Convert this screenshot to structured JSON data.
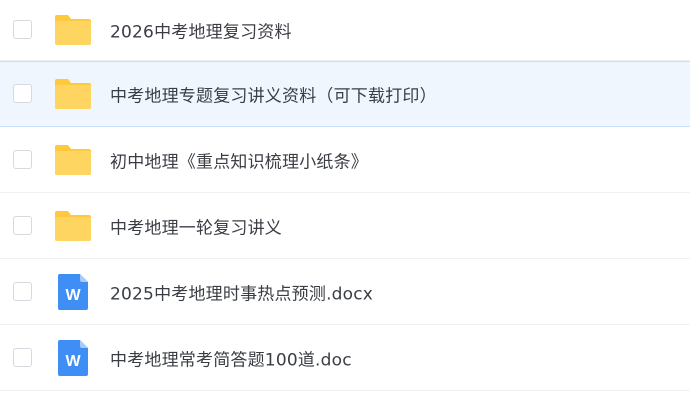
{
  "files": [
    {
      "name": "2026中考地理复习资料",
      "type": "folder",
      "icon": "folder-icon",
      "selected": false
    },
    {
      "name": "中考地理专题复习讲义资料（可下载打印）",
      "type": "folder",
      "icon": "folder-icon",
      "selected": true
    },
    {
      "name": "初中地理《重点知识梳理小纸条》",
      "type": "folder",
      "icon": "folder-icon",
      "selected": false
    },
    {
      "name": "中考地理一轮复习讲义",
      "type": "folder",
      "icon": "folder-icon",
      "selected": false
    },
    {
      "name": "2025中考地理时事热点预测.docx",
      "type": "word",
      "icon": "word-document-icon",
      "icon_letter": "W",
      "selected": false
    },
    {
      "name": "中考地理常考简答题100道.doc",
      "type": "word",
      "icon": "word-document-icon",
      "icon_letter": "W",
      "selected": false
    }
  ],
  "colors": {
    "folder": "#ffd561",
    "folder_back": "#ffc93d",
    "word": "#3e8ef6",
    "word_fold": "#a9cafb",
    "selected_row": "#f0f6fe"
  }
}
